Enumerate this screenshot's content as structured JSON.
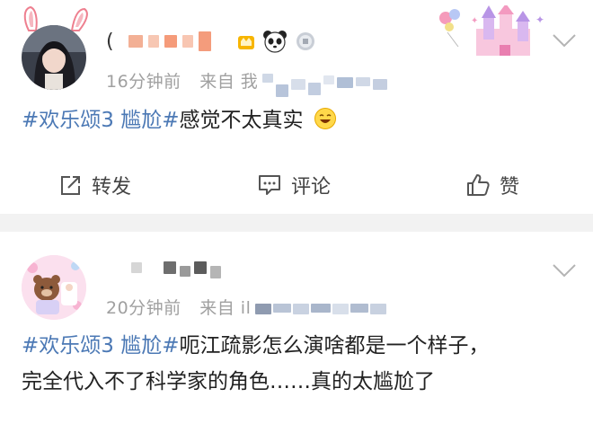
{
  "posts": [
    {
      "time": "16分钟前",
      "source_prefix": "来自",
      "source_visible": "我",
      "topic": "#欢乐颂3 尴尬#",
      "text": "感觉不太真实",
      "emoji": "laughing-face-emoji",
      "badges": [
        "crown-badge-icon",
        "panda-icon",
        "silver-medal-icon"
      ]
    },
    {
      "time": "20分钟前",
      "source_prefix": "来自",
      "source_visible": "il",
      "topic": "#欢乐颂3 尴尬#",
      "text_line1": "呃江疏影怎么演啥都是一个样子，",
      "text_line2": "完全代入不了科学家的角色……真的太尴尬了"
    }
  ],
  "actions": {
    "repost": "转发",
    "comment": "评论",
    "like": "赞"
  },
  "colors": {
    "topic": "#4c79b5",
    "meta": "#a0a0a0",
    "separator": "#f2f2f2"
  }
}
